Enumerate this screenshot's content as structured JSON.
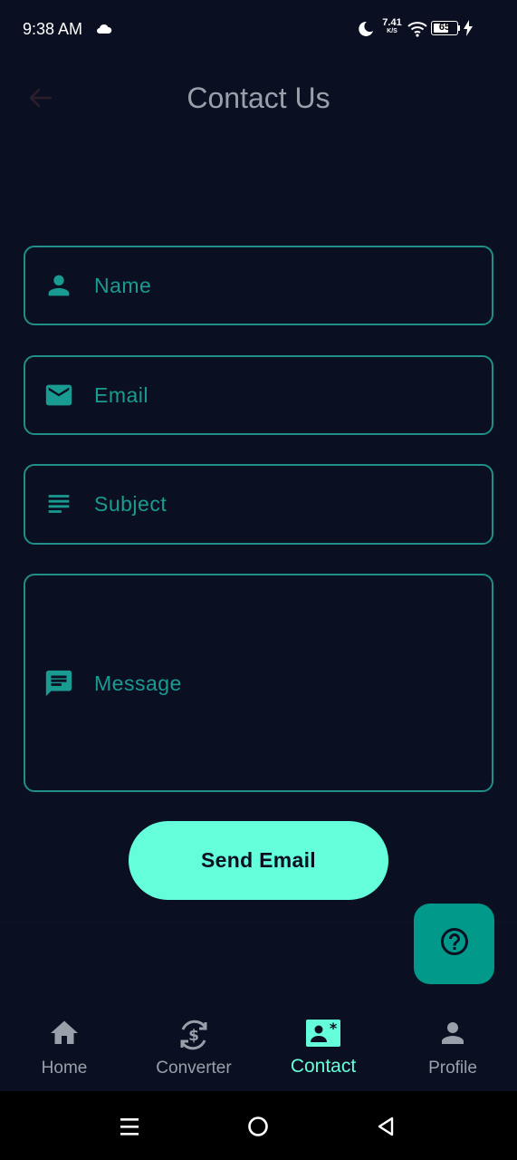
{
  "status_bar": {
    "time": "9:38 AM",
    "speed_value": "7.41",
    "speed_unit": "K/S",
    "battery": "65"
  },
  "app_bar": {
    "title": "Contact Us",
    "back_icon": "arrow-back-icon"
  },
  "form": {
    "name": {
      "placeholder": "Name",
      "icon": "person-icon"
    },
    "email": {
      "placeholder": "Email",
      "icon": "mail-icon"
    },
    "subject": {
      "placeholder": "Subject",
      "icon": "subject-icon"
    },
    "message": {
      "placeholder": "Message",
      "icon": "chat-icon"
    },
    "send_label": "Send Email"
  },
  "fab": {
    "icon": "help-icon"
  },
  "bottom_nav": {
    "items": [
      {
        "label": "Home",
        "icon": "home-icon",
        "active": false
      },
      {
        "label": "Converter",
        "icon": "currency-exchange-icon",
        "active": false
      },
      {
        "label": "Contact",
        "icon": "contact-card-icon",
        "active": true
      },
      {
        "label": "Profile",
        "icon": "person-icon",
        "active": false
      }
    ]
  },
  "colors": {
    "background": "#0a0f21",
    "accent": "#64ffda",
    "field_border": "#1f8f87",
    "field_text": "#1a9b91",
    "fab": "#00998a",
    "inactive": "#9aa0aa"
  }
}
